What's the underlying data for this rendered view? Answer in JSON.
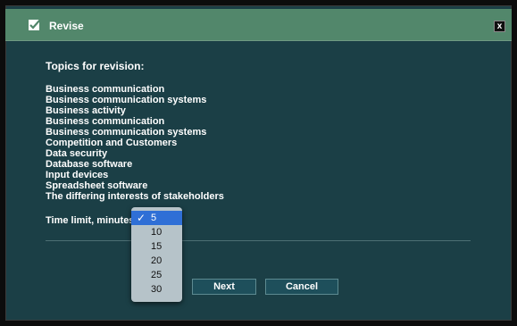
{
  "window": {
    "title": "Revise",
    "close_label": "x"
  },
  "content": {
    "heading": "Topics for revision:",
    "topics": [
      "Business communication",
      "Business communication systems",
      "Business activity",
      "Business communication",
      "Business communication systems",
      "Competition and Customers",
      "Data security",
      "Database software",
      "Input devices",
      "Spreadsheet software",
      "The differing interests of stakeholders"
    ],
    "time_label": "Time limit, minutes"
  },
  "time_limit": {
    "selected": "5",
    "options": [
      "5",
      "10",
      "15",
      "20",
      "25",
      "30"
    ]
  },
  "buttons": {
    "next": "Next",
    "cancel": "Cancel"
  },
  "colors": {
    "window_bg": "#1b3f46",
    "titlebar_bg": "#52876b",
    "selection": "#2f6fd6"
  }
}
